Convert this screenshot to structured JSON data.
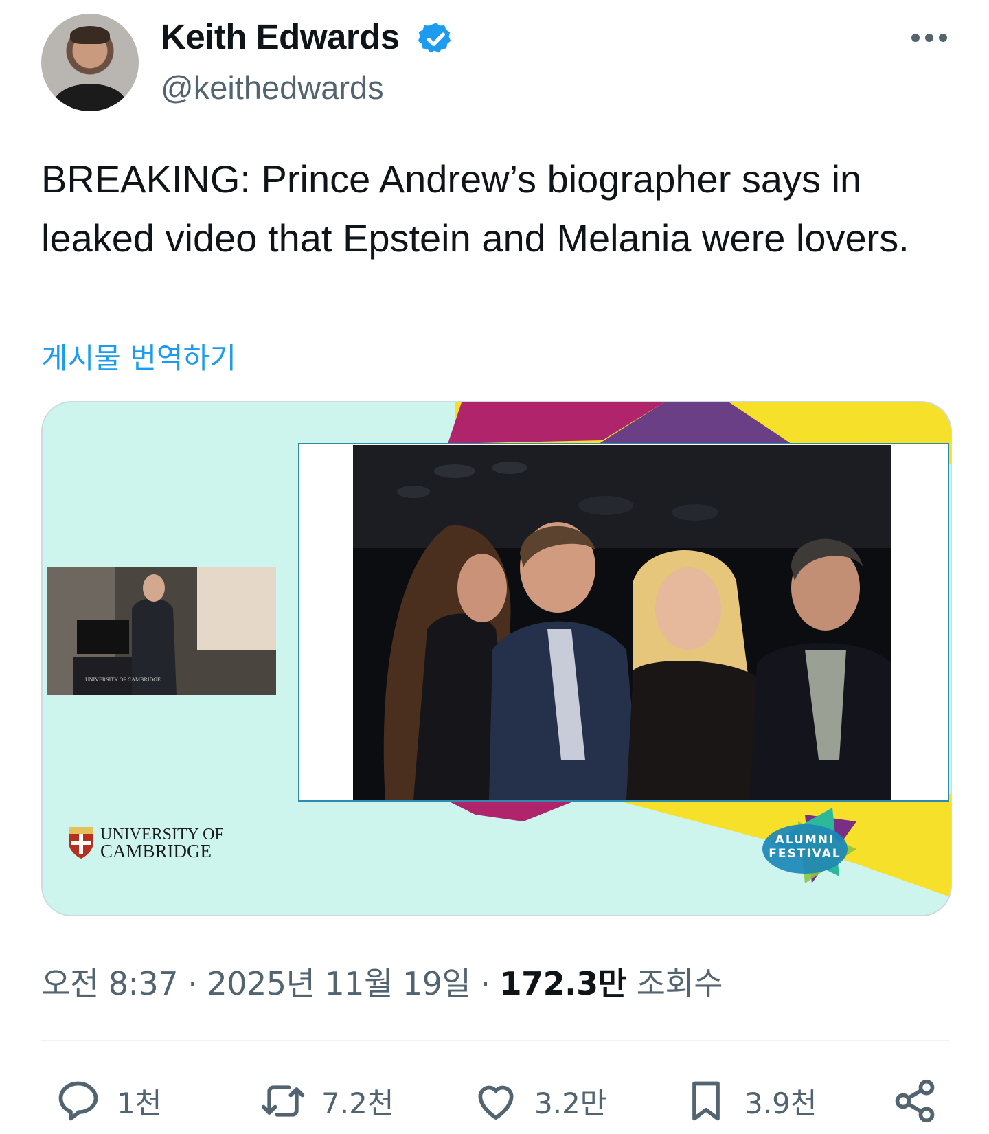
{
  "author": {
    "name": "Keith Edwards",
    "handle": "@keithedwards",
    "verified": true,
    "verified_color": "#1d9bf0"
  },
  "tweet": {
    "text": "BREAKING: Prince Andrew’s biographer says in leaked video that Epstein and Melania were lovers.",
    "translate_label": "게시물 번역하기"
  },
  "media": {
    "slide_logo_text": "UNIVERSITY OF CAMBRIDGE",
    "slide_badge_text": "ALUMNI FESTIVAL",
    "inset_podium_text": "UNIVERSITY OF CAMBRIDGE",
    "colors": {
      "background": "#cdf5ee",
      "magenta": "#b0246b",
      "purple": "#6a3f86",
      "yellow": "#f7e02a",
      "frame": "#2d8ab0"
    }
  },
  "meta": {
    "time": "오전 8:37",
    "separator1": "·",
    "date": "2025년 11월 19일",
    "separator2": "·",
    "views_count": "172.3만",
    "views_label": "조회수"
  },
  "actions": {
    "replies": "1천",
    "reposts": "7.2천",
    "likes": "3.2만",
    "bookmarks": "3.9천"
  },
  "icons": [
    "verified-badge-icon",
    "more-options-icon",
    "reply-icon",
    "repost-icon",
    "like-icon",
    "bookmark-icon",
    "share-icon"
  ]
}
